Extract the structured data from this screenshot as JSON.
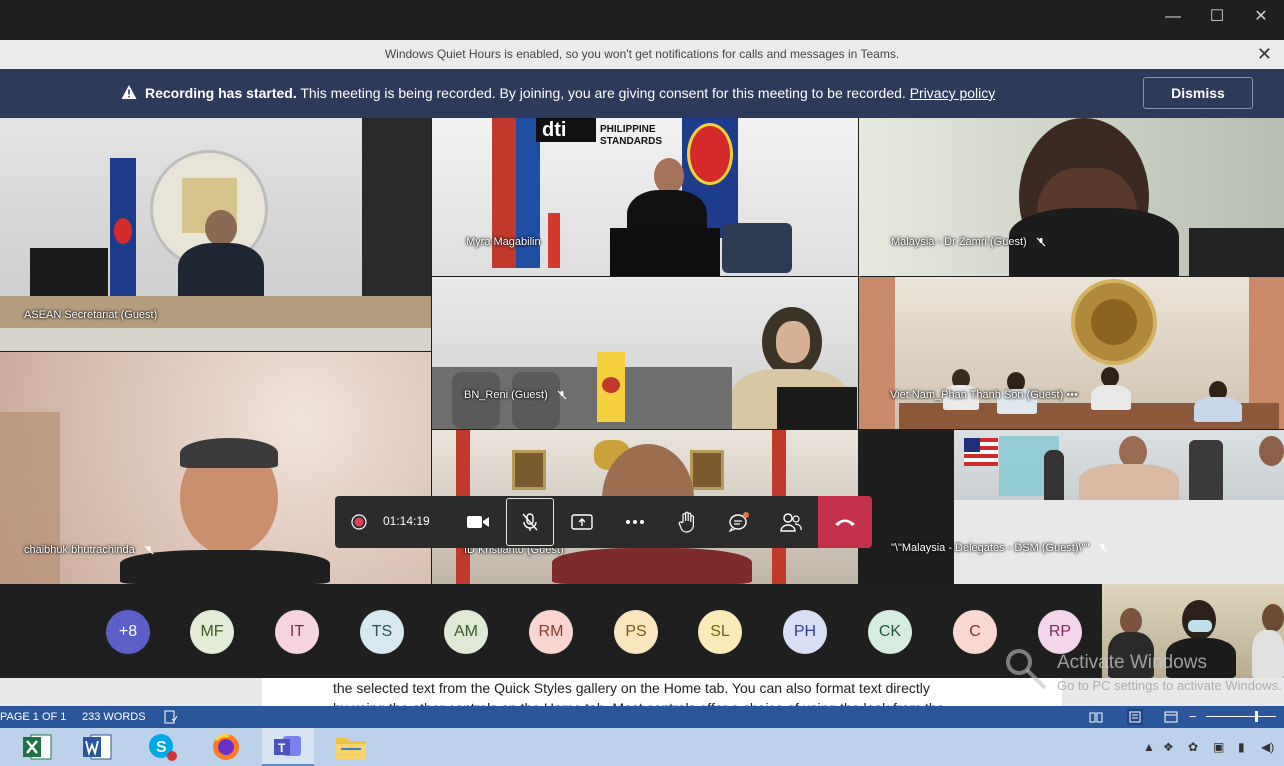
{
  "window": {
    "minimize": "—",
    "maximize": "☐",
    "close": "✕"
  },
  "quiet_hours": {
    "message": "Windows Quiet Hours is enabled, so you won't get notifications for calls and messages in Teams.",
    "close": "✕"
  },
  "recording": {
    "bold": "Recording has started.",
    "message": " This meeting is being recorded. By joining, you are giving consent for this meeting to be recorded. ",
    "link": "Privacy policy",
    "dismiss": "Dismiss"
  },
  "tiles": [
    {
      "label": "ASEAN Secretariat (Guest)"
    },
    {
      "label": "Myra Magabilin"
    },
    {
      "label": "Malaysia - Dr Zamri (Guest)"
    },
    {
      "label": "BN_Reni (Guest)"
    },
    {
      "label": "Viet Nam_Phan Thanh Son (Guest)"
    },
    {
      "label": "chaibhuk bhutrachinda"
    },
    {
      "label": "ID Kristianto (Guest)"
    },
    {
      "label": "\"\\\"Malaysia - Delegates - DSM (Guest)\\\"\""
    }
  ],
  "tile_signs": {
    "philippine_standards": "PHILIPPINE\nSTANDARDS",
    "bps_logo": "dti"
  },
  "controls": {
    "timer": "01:14:19"
  },
  "avatars": [
    {
      "initials": "+8",
      "bg": "#5b5fc7",
      "fg": "#ffffff"
    },
    {
      "initials": "MF",
      "bg": "#e3ecd6",
      "fg": "#3d5a1e"
    },
    {
      "initials": "IT",
      "bg": "#f6d4df",
      "fg": "#8a2a4d"
    },
    {
      "initials": "TS",
      "bg": "#d7e8ee",
      "fg": "#2a5466"
    },
    {
      "initials": "AM",
      "bg": "#dfe9d6",
      "fg": "#3a5a26"
    },
    {
      "initials": "RM",
      "bg": "#f8d6cf",
      "fg": "#8b3a2a"
    },
    {
      "initials": "PS",
      "bg": "#f9e6bf",
      "fg": "#7a5a12"
    },
    {
      "initials": "SL",
      "bg": "#f9eab8",
      "fg": "#7a6012"
    },
    {
      "initials": "PH",
      "bg": "#d8def4",
      "fg": "#2d3f86"
    },
    {
      "initials": "CK",
      "bg": "#d6ece1",
      "fg": "#235a3e"
    },
    {
      "initials": "C",
      "bg": "#f9d8d2",
      "fg": "#8b2f22"
    },
    {
      "initials": "RP",
      "bg": "#f3d6ea",
      "fg": "#7d2a63"
    }
  ],
  "document": {
    "line1": "the selected text from the Quick Styles gallery on the Home tab. You can also format text directly",
    "line2": "by using the other controls on the Home tab. Most controls offer a choice of using the look from the"
  },
  "watermark": {
    "title": "Activate Windows",
    "subtitle": "Go to PC settings to activate Windows."
  },
  "statusbar": {
    "page": "PAGE 1 OF 1",
    "words": "233 WORDS"
  },
  "colors": {
    "teams_dark": "#1f1f1f",
    "banner": "#2e3a5c",
    "hangup": "#c4314b",
    "word_blue": "#2b579a",
    "taskbar": "#bcd2ea"
  }
}
